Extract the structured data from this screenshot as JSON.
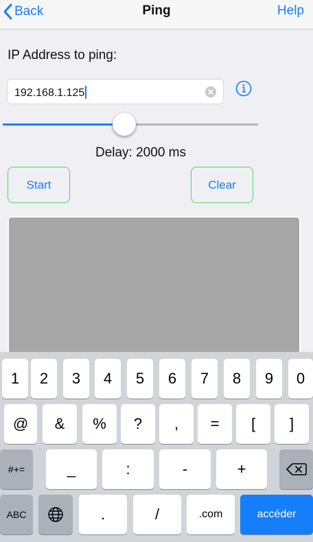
{
  "nav": {
    "back": "Back",
    "title": "Ping",
    "help": "Help"
  },
  "ip": {
    "label": "IP Address to ping:",
    "value": "192.168.1.125"
  },
  "slider": {
    "value_fraction": 0.475
  },
  "delay": {
    "text": "Delay: 2000 ms"
  },
  "buttons": {
    "start": "Start",
    "clear": "Clear"
  },
  "keyboard": {
    "row1": [
      "1",
      "2",
      "3",
      "4",
      "5",
      "6",
      "7",
      "8",
      "9",
      "0"
    ],
    "row2": [
      "@",
      "&",
      "%",
      "?",
      ",",
      "=",
      "[",
      "]"
    ],
    "row3": {
      "mode": "#+=",
      "keys": [
        "_",
        ":",
        "-",
        "+"
      ]
    },
    "row4": {
      "abc": "ABC",
      "period": ".",
      "slash": "/",
      "dotcom": ".com",
      "go": "accéder"
    }
  },
  "colors": {
    "accent": "#157efb",
    "button_border": "#4cd964",
    "output_bg": "#a7a7a7"
  }
}
